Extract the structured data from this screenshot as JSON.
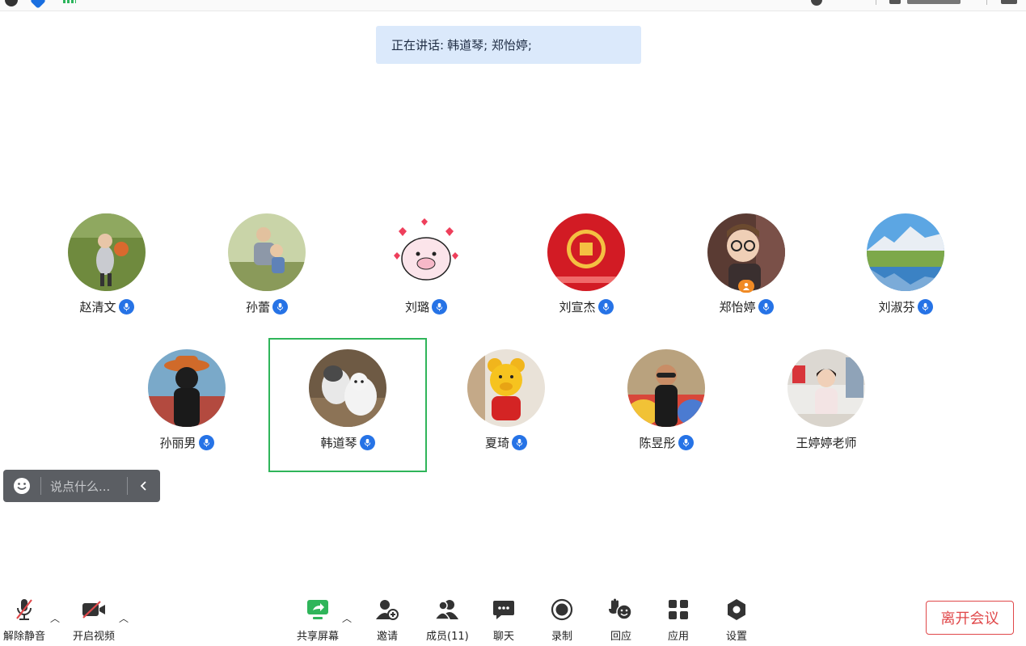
{
  "speaking_banner": {
    "label": "正在讲话:",
    "speakers": "韩道琴; 郑怡婷;"
  },
  "participants": [
    {
      "name": "赵清文",
      "avatar": "boy-with-basketball",
      "mic": "active"
    },
    {
      "name": "孙蕾",
      "avatar": "father-and-child",
      "mic": "active"
    },
    {
      "name": "刘璐",
      "avatar": "cartoon-pig",
      "mic": "active"
    },
    {
      "name": "刘宣杰",
      "avatar": "red-liu-emblem",
      "mic": "active"
    },
    {
      "name": "郑怡婷",
      "avatar": "girl-with-glasses",
      "mic": "speaking",
      "host": true
    },
    {
      "name": "刘淑芬",
      "avatar": "mountain-lake",
      "mic": "active"
    },
    {
      "name": "孙丽男",
      "avatar": "child-with-hat",
      "mic": "active"
    },
    {
      "name": "韩道琴",
      "avatar": "two-cats",
      "mic": "speaking",
      "active_speaker": true
    },
    {
      "name": "夏琦",
      "avatar": "yellow-bear-toy",
      "mic": "active"
    },
    {
      "name": "陈昱彤",
      "avatar": "kid-with-sunglasses",
      "mic": "active"
    },
    {
      "name": "王婷婷老师",
      "avatar": "teacher-office",
      "mic": "none"
    }
  ],
  "chat": {
    "placeholder": "说点什么...",
    "emoji_icon": "smiley-icon",
    "collapse_icon": "chevron-left-icon"
  },
  "toolbar": {
    "unmute": "解除静音",
    "start_video": "开启视频",
    "share_screen": "共享屏幕",
    "invite": "邀请",
    "members": "成员(11)",
    "chat": "聊天",
    "record": "录制",
    "reactions": "回应",
    "apps": "应用",
    "settings": "设置",
    "leave": "离开会议"
  },
  "colors": {
    "accent_blue": "#2673e6",
    "active_green": "#2fb55a",
    "leave_red": "#e0484a",
    "banner_bg": "#dbe9fb"
  }
}
